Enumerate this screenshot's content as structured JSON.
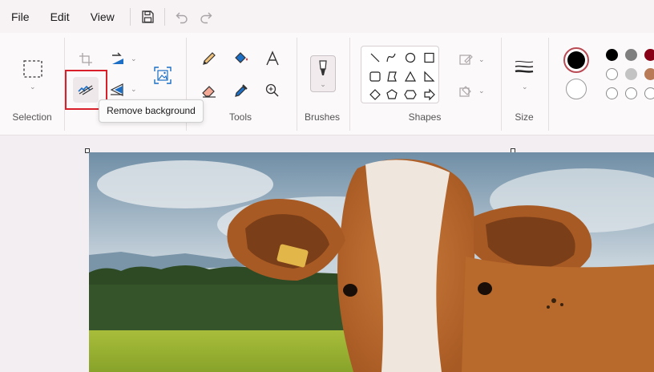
{
  "menu": {
    "file": "File",
    "edit": "Edit",
    "view": "View"
  },
  "groups": {
    "selection": "Selection",
    "tools": "Tools",
    "brushes": "Brushes",
    "shapes": "Shapes",
    "size": "Size"
  },
  "tooltip": "Remove background",
  "colors": {
    "primary": "#000000",
    "secondary": "#ffffff",
    "palette_row1": [
      "#000000",
      "#7f7f7f",
      "#880015"
    ],
    "palette_row2": [
      "#ffffff",
      "#c3c3c3",
      "#b97a57"
    ],
    "palette_row3": [
      "#ffffff",
      "#ffffff",
      "#ffffff"
    ]
  },
  "icons": {
    "save": "save-icon",
    "undo": "undo-icon",
    "redo": "redo-icon",
    "remove_background": "remove-background-icon"
  }
}
